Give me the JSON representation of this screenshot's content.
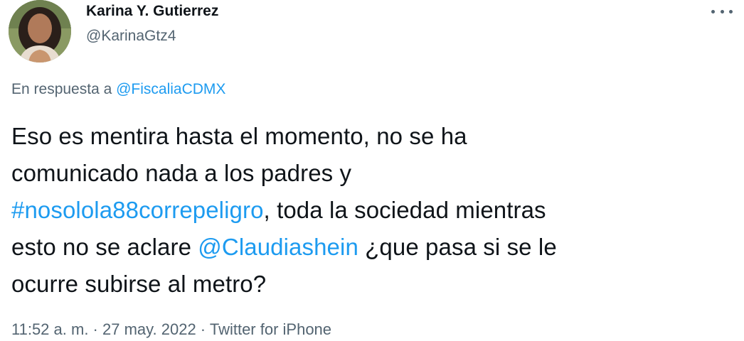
{
  "author": {
    "display_name": "Karina Y. Gutierrez",
    "handle": "@KarinaGtz4"
  },
  "reply_to": {
    "prefix": "En respuesta a ",
    "mention": "@FiscaliaCDMX"
  },
  "tweet": {
    "line1": "Eso es mentira hasta el momento, no se ha",
    "line2": "comunicado nada a los padres y",
    "hashtag": "#nosolola88correpeligro",
    "line3_rest": ", toda la sociedad mientras",
    "line4_start": "esto no se aclare ",
    "mention": "@Claudiashein",
    "line4_rest": " ¿que pasa si se le",
    "line5": "ocurre subirse al metro?"
  },
  "meta": {
    "time": "11:52 a. m.",
    "sep1": " · ",
    "date": "27 may. 2022",
    "sep2": " · ",
    "source": "Twitter for iPhone"
  },
  "icons": {
    "more": "more-horizontal-icon"
  },
  "colors": {
    "link": "#1d9bf0",
    "text": "#0f1419",
    "secondary": "#536471",
    "background": "#ffffff"
  }
}
